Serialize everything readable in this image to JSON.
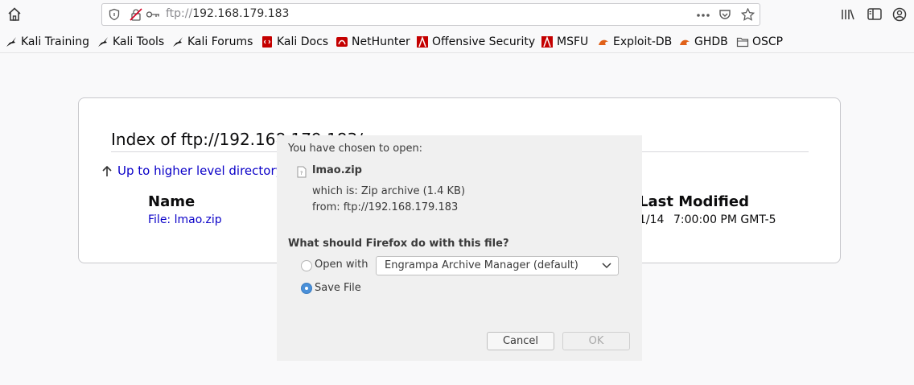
{
  "toolbar": {
    "url_scheme": "ftp://",
    "url_host": "192.168.179.183"
  },
  "bookmarks": [
    {
      "label": "Kali Training",
      "icon": "kali-dragon-icon"
    },
    {
      "label": "Kali Tools",
      "icon": "kali-dragon-icon"
    },
    {
      "label": "Kali Forums",
      "icon": "kali-dragon-icon"
    },
    {
      "label": "Kali Docs",
      "icon": "kali-docs-icon"
    },
    {
      "label": "NetHunter",
      "icon": "nethunter-icon"
    },
    {
      "label": "Offensive Security",
      "icon": "offsec-icon"
    },
    {
      "label": "MSFU",
      "icon": "offsec-icon"
    },
    {
      "label": "Exploit-DB",
      "icon": "exploitdb-icon"
    },
    {
      "label": "GHDB",
      "icon": "exploitdb-icon"
    },
    {
      "label": "OSCP",
      "icon": "folder-icon"
    }
  ],
  "page": {
    "title": "Index of ftp://192.168.179.183/",
    "up_link": "Up to higher level directory",
    "col_name": "Name",
    "col_modified": "Last Modified",
    "file_link": "File: lmao.zip",
    "file_date": "1/14",
    "file_time": "7:00:00 PM GMT-5"
  },
  "dialog": {
    "chosen": "You have chosen to open:",
    "filename": "lmao.zip",
    "which_is": "which is:  Zip archive (1.4 KB)",
    "from": "from:  ftp://192.168.179.183",
    "question": "What should Firefox do with this file?",
    "open_with_label": "Open with",
    "open_with_app": "Engrampa Archive Manager (default)",
    "save_file_label": "Save File",
    "selected_option": "save",
    "cancel": "Cancel",
    "ok": "OK"
  },
  "colors": {
    "link": "#0a00c8",
    "radio_selected": "#4a90d9",
    "dialog_bg": "#f0f0f0"
  }
}
